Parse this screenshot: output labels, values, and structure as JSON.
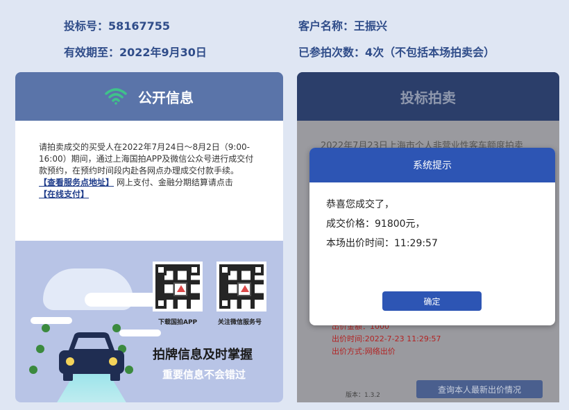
{
  "header": {
    "bid_no": "投标号：58167755",
    "valid_until": "有效期至：2022年9月30日",
    "customer_name": "客户名称：王振兴",
    "attend_count": "已参拍次数：4次（不包括本场拍卖会）"
  },
  "left_panel": {
    "title": "公开信息",
    "notice_text": "请拍卖成交的买受人在2022年7月24日～8月2日（9:00-16:00）期间，通过上海国拍APP及微信公众号进行成交付款预约，在预约时间段内赴各网点办理成交付款手续。",
    "service_link": "【查看服务点地址】",
    "notice_tail": "网上支付、金融分期结算请点击",
    "pay_link": "【在线支付】",
    "qr_app_label": "下载国拍APP",
    "qr_wechat_label": "关注微信服务号",
    "slogan": "拍牌信息及时掌握",
    "sub_slogan": "重要信息不会错过"
  },
  "right_panel": {
    "title": "投标拍卖",
    "behind_title": "2022年7月23日上海市个人非营业性客车额度拍卖",
    "red_line_1": "出价金额：1000",
    "red_line_2": "出价时间:2022-7-23 11:29:57",
    "red_line_3": "出价方式:网络出价",
    "version": "版本：1.3.2",
    "query_button": "查询本人最新出价情况"
  },
  "modal": {
    "title": "系统提示",
    "line1": "恭喜您成交了，",
    "line2": "成交价格：91800元，",
    "line3": "本场出价时间：11:29:57",
    "confirm": "确定"
  }
}
